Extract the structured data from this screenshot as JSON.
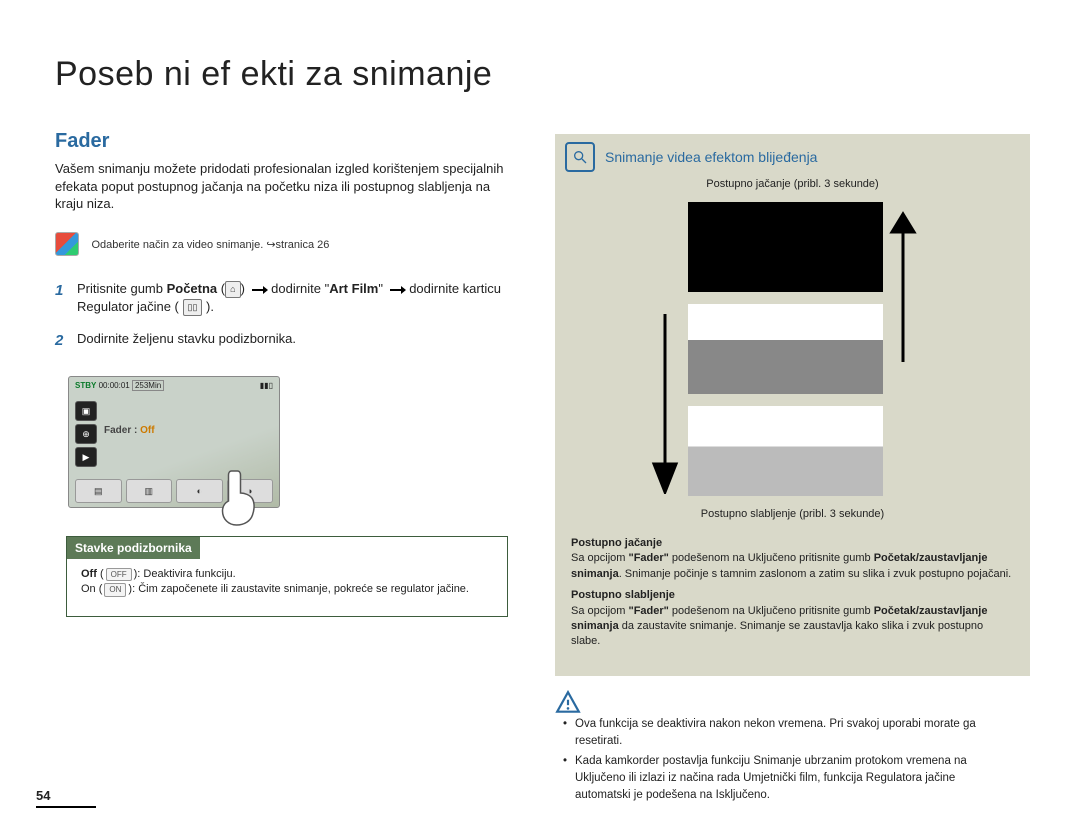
{
  "title": "Poseb ni ef  ekti za snimanje",
  "section": "Fader",
  "intro": "Vašem snimanju možete pridodati profesionalan izgled korištenjem specijalnih efekata poput postupnog jačanja na početku niza ili postupnog slabljenja na kraju niza.",
  "mode_note": "Odaberite način za video snimanje. ↪stranica 26",
  "step1_a": "Pritisnite gumb ",
  "step1_b": "Početna",
  "step1_c": " (",
  "step1_d": ") ",
  "step1_e": " dodirnite \"",
  "step1_f": "Art Film",
  "step1_g": "\" ",
  "step1_h": " dodirnite karticu Regulator jačine ( ",
  "step1_i": " ).",
  "step2": "Dodirnite željenu stavku podizbornika.",
  "lcd": {
    "stby": "STBY",
    "time": "00:00:01",
    "remain": "253Min",
    "fader_label": "Fader : ",
    "fader_value": "Off"
  },
  "submenu": {
    "head": "Stavke podizbornika",
    "off_label": "Off",
    "off_text": ": Deaktivira funkciju.",
    "on_label": "On",
    "on_text": ": Čim započenete ili zaustavite snimanje, pokreće se regulator jačine."
  },
  "right": {
    "title": "Snimanje videa efektom blijeđenja",
    "top_label": "Postupno jačanje (pribl. 3 sekunde)",
    "bottom_label": "Postupno slabljenje (pribl. 3 sekunde)",
    "fadein_hd": "Postupno jačanje",
    "fadein_a": "Sa opcijom ",
    "fadein_b": "\"Fader\"",
    "fadein_c": " podešenom na Uključeno pritisnite gumb ",
    "fadein_d": "Početak/zaustavljanje snimanja",
    "fadein_e": ". Snimanje počinje s tamnim zaslonom a zatim su slika i zvuk postupno pojačani.",
    "fadeout_hd": "Postupno slabljenje",
    "fadeout_a": "Sa opcijom ",
    "fadeout_b": "\"Fader\"",
    "fadeout_c": " podešenom na Uključeno pritisnite gumb ",
    "fadeout_d": "Početak/zaustavljanje snimanja",
    "fadeout_e": " da zaustavite snimanje. Snimanje se zaustavlja kako slika i zvuk postupno slabe."
  },
  "notes": {
    "n1": "Ova funkcija se deaktivira nakon nekon vremena. Pri svakoj uporabi morate ga resetirati.",
    "n2": "Kada kamkorder postavlja funkciju Snimanje ubrzanim protokom vremena na Uključeno ili izlazi iz načina rada Umjetnički film, funkcija Regulatora jačine automatski je podešena na Isključeno."
  },
  "page_number": "54",
  "icons": {
    "home": "⌂",
    "vol": "▯▯",
    "off": "OFF",
    "on": "ON"
  }
}
